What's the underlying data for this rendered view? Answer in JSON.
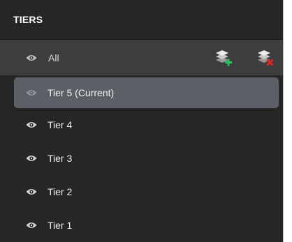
{
  "panel": {
    "title": "TIERS",
    "all_label": "All",
    "add_tier_icon": "layers-add-icon",
    "remove_tier_icon": "layers-remove-icon"
  },
  "tiers": [
    {
      "label": "Tier 5 (Current)",
      "selected": true
    },
    {
      "label": "Tier 4",
      "selected": false
    },
    {
      "label": "Tier 3",
      "selected": false
    },
    {
      "label": "Tier 2",
      "selected": false
    },
    {
      "label": "Tier 1",
      "selected": false
    }
  ],
  "colors": {
    "panel_bg": "#262626",
    "all_row_bg": "#3d3d3d",
    "selected_bg": "#5a6066",
    "add_accent": "#22c55e",
    "remove_accent": "#e02424"
  }
}
